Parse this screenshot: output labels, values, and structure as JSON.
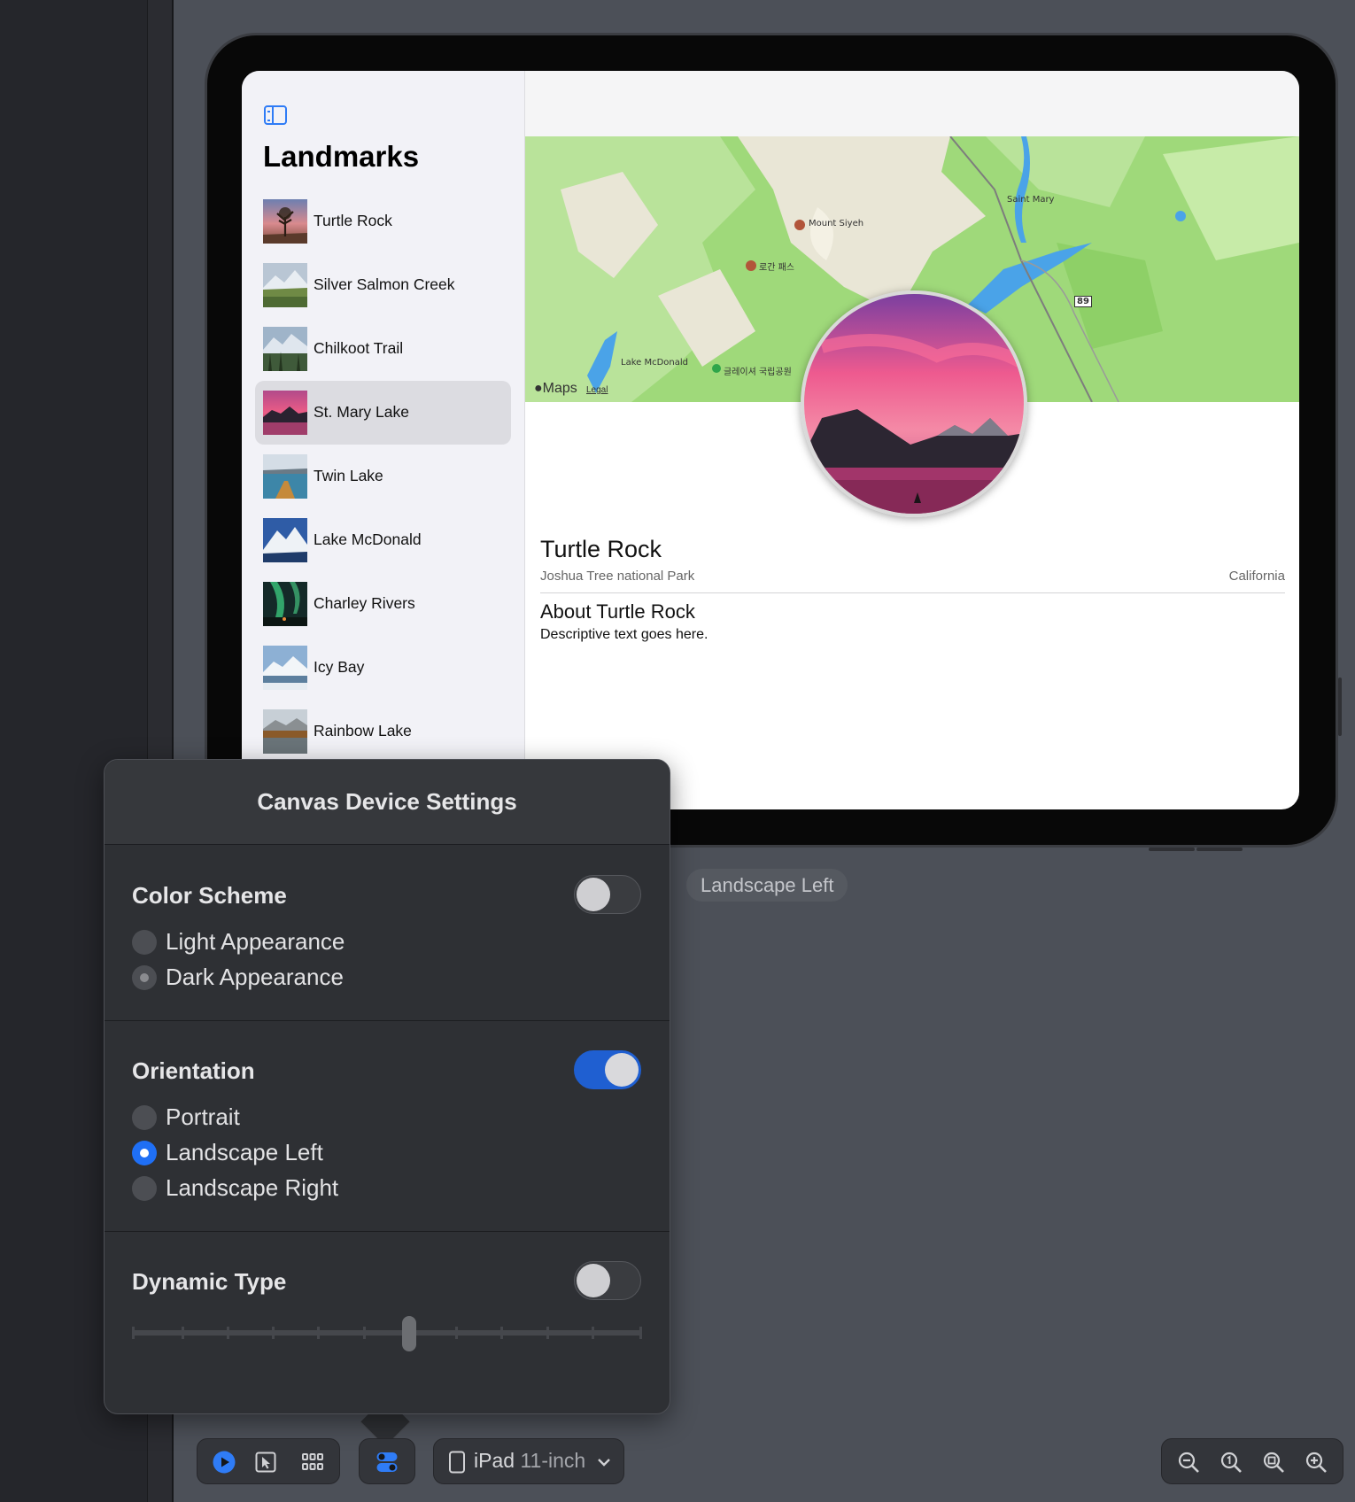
{
  "canvas": {
    "orientation_tag": "Landscape Left"
  },
  "app": {
    "sidebar_title": "Landmarks",
    "landmarks": [
      {
        "name": "Turtle Rock"
      },
      {
        "name": "Silver Salmon Creek"
      },
      {
        "name": "Chilkoot Trail"
      },
      {
        "name": "St. Mary Lake",
        "selected": true
      },
      {
        "name": "Twin Lake"
      },
      {
        "name": "Lake McDonald"
      },
      {
        "name": "Charley Rivers"
      },
      {
        "name": "Icy Bay"
      },
      {
        "name": "Rainbow Lake"
      }
    ],
    "map": {
      "labels": [
        "Saint Mary",
        "Mount Siyeh",
        "로간 패스",
        "Lake McDonald",
        "글레이셔 국립공원",
        "89"
      ],
      "attribution": "Maps",
      "legal": "Legal"
    },
    "detail": {
      "name": "Turtle Rock",
      "park": "Joshua Tree national Park",
      "state": "California",
      "about_title": "About Turtle Rock",
      "about_text": "Descriptive text goes here."
    }
  },
  "popover": {
    "title": "Canvas Device Settings",
    "color_scheme": {
      "title": "Color Scheme",
      "enabled": false,
      "options": [
        "Light Appearance",
        "Dark Appearance"
      ]
    },
    "orientation": {
      "title": "Orientation",
      "enabled": true,
      "options": [
        "Portrait",
        "Landscape Left",
        "Landscape Right"
      ],
      "selected": "Landscape Left"
    },
    "dynamic_type": {
      "title": "Dynamic Type",
      "enabled": false,
      "level_fraction": 0.55
    }
  },
  "toolbar": {
    "device_name": "iPad",
    "device_size": "11-inch",
    "icons": [
      "live-preview-icon",
      "selectable-mode-icon",
      "variants-grid-icon",
      "device-settings-icon",
      "zoom-out-icon",
      "actual-size-icon",
      "zoom-to-fit-icon",
      "zoom-in-icon"
    ],
    "accent_color": "#2f7cf6"
  }
}
